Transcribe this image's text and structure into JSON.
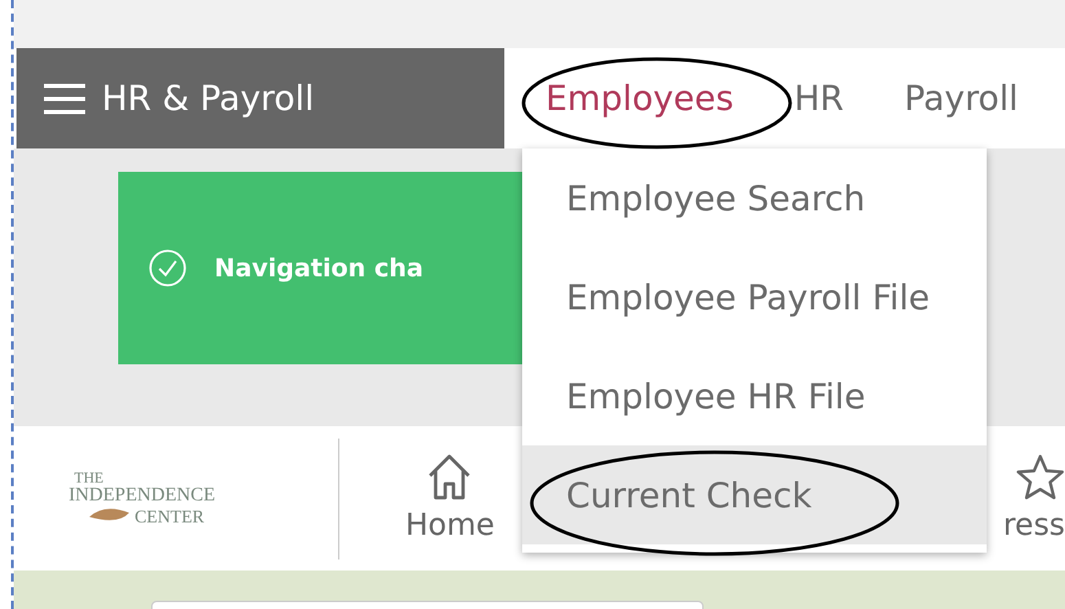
{
  "header": {
    "menu_title": "HR & Payroll"
  },
  "nav": [
    {
      "label": "Employees",
      "selected": true
    },
    {
      "label": "HR",
      "selected": false
    },
    {
      "label": "Payroll",
      "selected": false
    }
  ],
  "banner": {
    "message": "Navigation cha"
  },
  "dropdown": [
    {
      "label": "Employee Search",
      "selected": false
    },
    {
      "label": "Employee Payroll File",
      "selected": false
    },
    {
      "label": "Employee HR File",
      "selected": false
    },
    {
      "label": "Current Check",
      "selected": true
    }
  ],
  "logo": {
    "lines": [
      "THE",
      "INDEPENDENCE",
      "CENTER"
    ]
  },
  "toolbar": [
    {
      "kind": "home",
      "label": "Home"
    },
    {
      "kind": "star",
      "label": "ress"
    }
  ]
}
